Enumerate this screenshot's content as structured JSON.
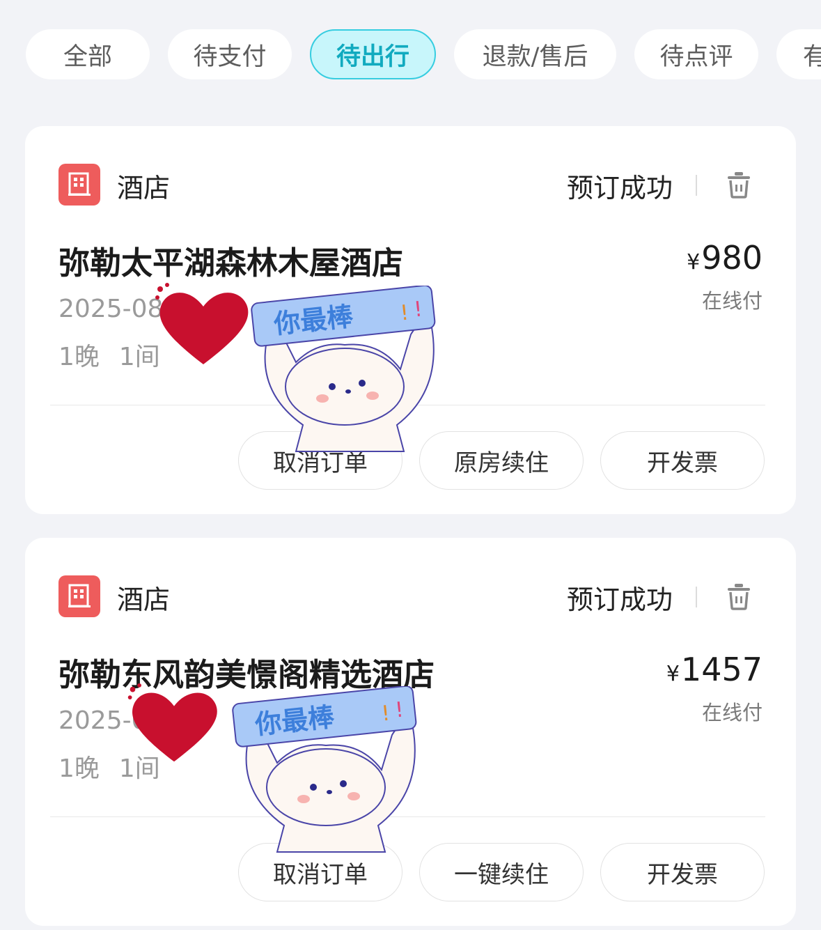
{
  "tabs": [
    {
      "label": "全部"
    },
    {
      "label": "待支付"
    },
    {
      "label": "待出行",
      "active": true
    },
    {
      "label": "退款/售后"
    },
    {
      "label": "待点评"
    },
    {
      "label": "有"
    }
  ],
  "orders": [
    {
      "type": "酒店",
      "status": "预订成功",
      "hotel_name": "弥勒太平湖森林木屋酒店",
      "currency": "¥",
      "price": "980",
      "pay_method": "在线付",
      "dates": "2025-08",
      "nights": "1晚",
      "rooms": "1间",
      "buttons": [
        "取消订单",
        "原房续住",
        "开发票"
      ]
    },
    {
      "type": "酒店",
      "status": "预订成功",
      "hotel_name": "弥勒东风韵美憬阁精选酒店",
      "currency": "¥",
      "price": "1457",
      "pay_method": "在线付",
      "dates": "2025-0",
      "nights": "1晚",
      "rooms": "1间",
      "buttons": [
        "取消订单",
        "一键续住",
        "开发票"
      ]
    }
  ],
  "sticker": {
    "text": "你最棒"
  },
  "colors": {
    "accent": "#36cde0",
    "hotel_icon": "#ee5c5c",
    "heart": "#c8102e"
  }
}
